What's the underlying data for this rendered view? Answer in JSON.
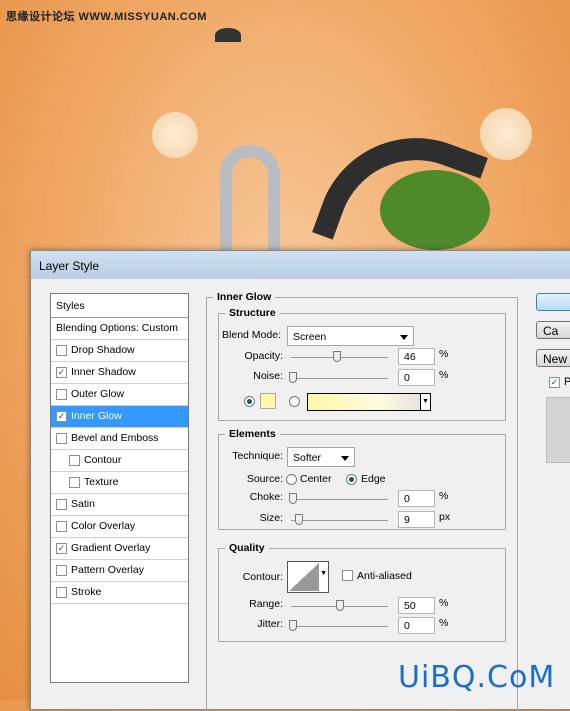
{
  "watermark": "思缘设计论坛 WWW.MISSYUAN.COM",
  "dialog": {
    "title": "Layer Style"
  },
  "styles_panel": {
    "header": "Styles",
    "blending": "Blending Options: Custom",
    "items": [
      {
        "label": "Drop Shadow",
        "checked": false,
        "indent": false
      },
      {
        "label": "Inner Shadow",
        "checked": true,
        "indent": false
      },
      {
        "label": "Outer Glow",
        "checked": false,
        "indent": false
      },
      {
        "label": "Inner Glow",
        "checked": true,
        "indent": false,
        "selected": true
      },
      {
        "label": "Bevel and Emboss",
        "checked": false,
        "indent": false
      },
      {
        "label": "Contour",
        "checked": false,
        "indent": true
      },
      {
        "label": "Texture",
        "checked": false,
        "indent": true
      },
      {
        "label": "Satin",
        "checked": false,
        "indent": false
      },
      {
        "label": "Color Overlay",
        "checked": false,
        "indent": false
      },
      {
        "label": "Gradient Overlay",
        "checked": true,
        "indent": false
      },
      {
        "label": "Pattern Overlay",
        "checked": false,
        "indent": false
      },
      {
        "label": "Stroke",
        "checked": false,
        "indent": false
      }
    ]
  },
  "inner_glow": {
    "title": "Inner Glow",
    "structure": {
      "title": "Structure",
      "blend_mode_label": "Blend Mode:",
      "blend_mode": "Screen",
      "opacity_label": "Opacity:",
      "opacity": "46",
      "noise_label": "Noise:",
      "noise": "0",
      "percent": "%",
      "glow_color": "#fff8a8",
      "color_mode": "solid"
    },
    "elements": {
      "title": "Elements",
      "technique_label": "Technique:",
      "technique": "Softer",
      "source_label": "Source:",
      "center": "Center",
      "edge": "Edge",
      "source": "Edge",
      "choke_label": "Choke:",
      "choke": "0",
      "size_label": "Size:",
      "size": "9",
      "px": "px"
    },
    "quality": {
      "title": "Quality",
      "contour_label": "Contour:",
      "anti_aliased": "Anti-aliased",
      "anti_aliased_checked": false,
      "range_label": "Range:",
      "range": "50",
      "jitter_label": "Jitter:",
      "jitter": "0"
    }
  },
  "buttons": {
    "ok": "",
    "cancel": "Ca",
    "new_style": "New",
    "preview": "P",
    "preview_checked": true
  },
  "logo": "UiBQ.CoM"
}
